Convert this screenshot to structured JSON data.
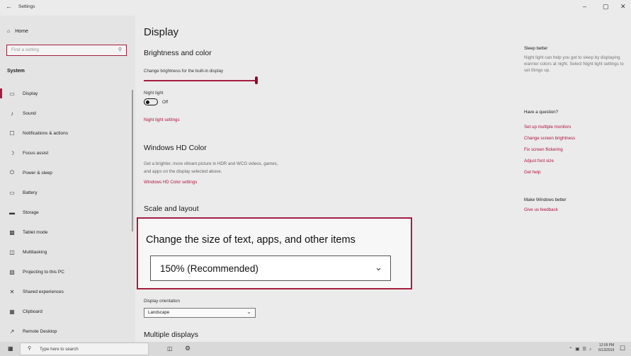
{
  "window": {
    "back_icon": "back-arrow-icon",
    "title": "Settings",
    "minimize": "–",
    "maximize": "▢",
    "close": "✕"
  },
  "sidebar": {
    "home_label": "Home",
    "search_placeholder": "Find a setting",
    "section_heading": "System",
    "items": [
      {
        "label": "Display",
        "icon": "monitor-icon",
        "active": true
      },
      {
        "label": "Sound",
        "icon": "speaker-icon"
      },
      {
        "label": "Notifications & actions",
        "icon": "notification-icon"
      },
      {
        "label": "Focus assist",
        "icon": "moon-icon"
      },
      {
        "label": "Power & sleep",
        "icon": "power-icon"
      },
      {
        "label": "Battery",
        "icon": "battery-icon"
      },
      {
        "label": "Storage",
        "icon": "storage-icon"
      },
      {
        "label": "Tablet mode",
        "icon": "tablet-icon"
      },
      {
        "label": "Multitasking",
        "icon": "multitasking-icon"
      },
      {
        "label": "Projecting to this PC",
        "icon": "projecting-icon"
      },
      {
        "label": "Shared experiences",
        "icon": "shared-icon"
      },
      {
        "label": "Clipboard",
        "icon": "clipboard-icon"
      },
      {
        "label": "Remote Desktop",
        "icon": "remote-icon"
      }
    ]
  },
  "main": {
    "title": "Display",
    "brightness_heading": "Brightness and color",
    "brightness_label": "Change brightness for the built-in display",
    "brightness_level": 0.98,
    "night_light_label": "Night light",
    "night_light_state": "Off",
    "night_light_link": "Night light settings",
    "hd_heading": "Windows HD Color",
    "hd_desc_1": "Get a brighter, more vibrant picture in HDR and WCG videos, games,",
    "hd_desc_2": "and apps on the display selected above.",
    "hd_link": "Windows HD Color settings",
    "scale_heading": "Scale and layout",
    "scale_label": "Change the size of text, apps, and other items",
    "scale_value": "150% (Recommended)",
    "orientation_label": "Display orientation",
    "orientation_value": "Landscape",
    "multi_heading": "Multiple displays"
  },
  "right_panel": {
    "sleep_heading": "Sleep better",
    "sleep_text": "Night light can help you get to sleep by displaying warmer colors at night. Select Night light settings to set things up.",
    "question_heading": "Have a question?",
    "links": [
      "Set up multiple monitors",
      "Change screen brightness",
      "Fix screen flickering",
      "Adjust font size",
      "Get help"
    ],
    "better_heading": "Make Windows better",
    "feedback_link": "Give us feedback"
  },
  "taskbar": {
    "search_text": "Type here to search",
    "time": "12:09 PM",
    "date": "6/13/2019"
  },
  "colors": {
    "accent": "#a51e3f",
    "link": "#b0143c",
    "sidebar_bg": "#e4e4e4",
    "main_bg": "#ebebeb"
  }
}
